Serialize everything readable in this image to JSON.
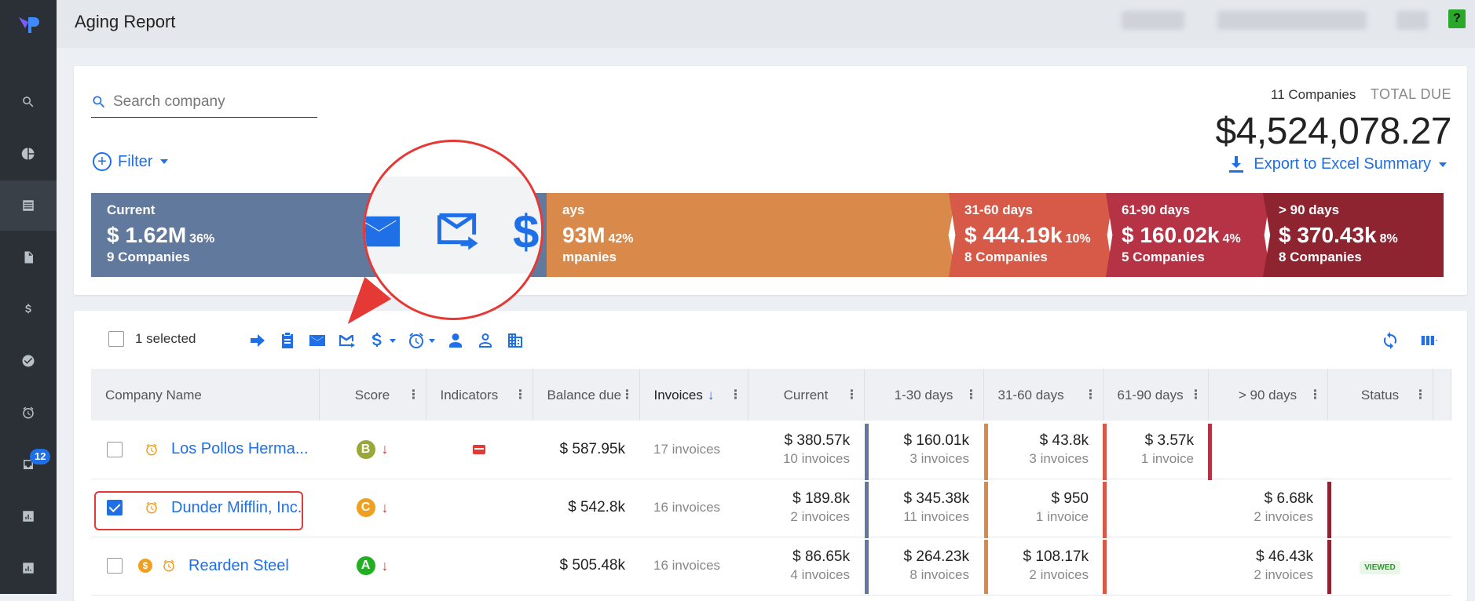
{
  "app": {
    "title": "Aging Report",
    "notifications_badge": "12",
    "help": "?"
  },
  "search": {
    "placeholder": "Search company"
  },
  "filter": {
    "label": "Filter"
  },
  "summary": {
    "companies": "11 Companies",
    "total_label": "TOTAL DUE",
    "total_amount": "$4,524,078.27",
    "export_label": "Export to Excel Summary"
  },
  "aging": [
    {
      "label": "Current",
      "amount": "$ 1.62M",
      "pct": "36%",
      "companies": "9 Companies",
      "color": "#62799e"
    },
    {
      "label": "ays",
      "amount": "93M",
      "pct": "42%",
      "companies": "mpanies",
      "color": "#d9894a"
    },
    {
      "label": "31-60 days",
      "amount": "$ 444.19k",
      "pct": "10%",
      "companies": "8 Companies",
      "color": "#d65a47"
    },
    {
      "label": "61-90 days",
      "amount": "$ 160.02k",
      "pct": "4%",
      "companies": "5 Companies",
      "color": "#b53344"
    },
    {
      "label": "> 90 days",
      "amount": "$ 370.43k",
      "pct": "8%",
      "companies": "8 Companies",
      "color": "#8e2430"
    }
  ],
  "toolbar": {
    "selected": "1 selected"
  },
  "table": {
    "headers": [
      "Company Name",
      "Score",
      "Indicators",
      "Balance due",
      "Invoices",
      "Current",
      "1-30 days",
      "31-60 days",
      "61-90 days",
      "> 90 days",
      "Status"
    ],
    "sort_arrow": "↓",
    "rows": [
      {
        "company": "Los Pollos Herma...",
        "score": "B",
        "score_color": "#9aa83a",
        "balance": "$ 587.95k",
        "invoices": "17 invoices",
        "current": "$ 380.57k",
        "current_sub": "10 invoices",
        "d1": "$ 160.01k",
        "d1_sub": "3 invoices",
        "d2": "$ 43.8k",
        "d2_sub": "3 invoices",
        "d3": "$ 3.57k",
        "d3_sub": "1 invoice",
        "d4": "",
        "d4_sub": "",
        "status": ""
      },
      {
        "company": "Dunder Mifflin, Inc.",
        "score": "C",
        "score_color": "#f0a020",
        "balance": "$ 542.8k",
        "invoices": "16 invoices",
        "current": "$ 189.8k",
        "current_sub": "2 invoices",
        "d1": "$ 345.38k",
        "d1_sub": "11 invoices",
        "d2": "$ 950",
        "d2_sub": "1 invoice",
        "d3": "",
        "d3_sub": "",
        "d4": "$ 6.68k",
        "d4_sub": "2 invoices",
        "status": ""
      },
      {
        "company": "Rearden Steel",
        "score": "A",
        "score_color": "#22b022",
        "balance": "$ 505.48k",
        "invoices": "16 invoices",
        "current": "$ 86.65k",
        "current_sub": "4 invoices",
        "d1": "$ 264.23k",
        "d1_sub": "8 invoices",
        "d2": "$ 108.17k",
        "d2_sub": "2 invoices",
        "d3": "",
        "d3_sub": "",
        "d4": "$ 46.43k",
        "d4_sub": "2 invoices",
        "status": "VIEWED",
        "coin": "$"
      }
    ]
  }
}
